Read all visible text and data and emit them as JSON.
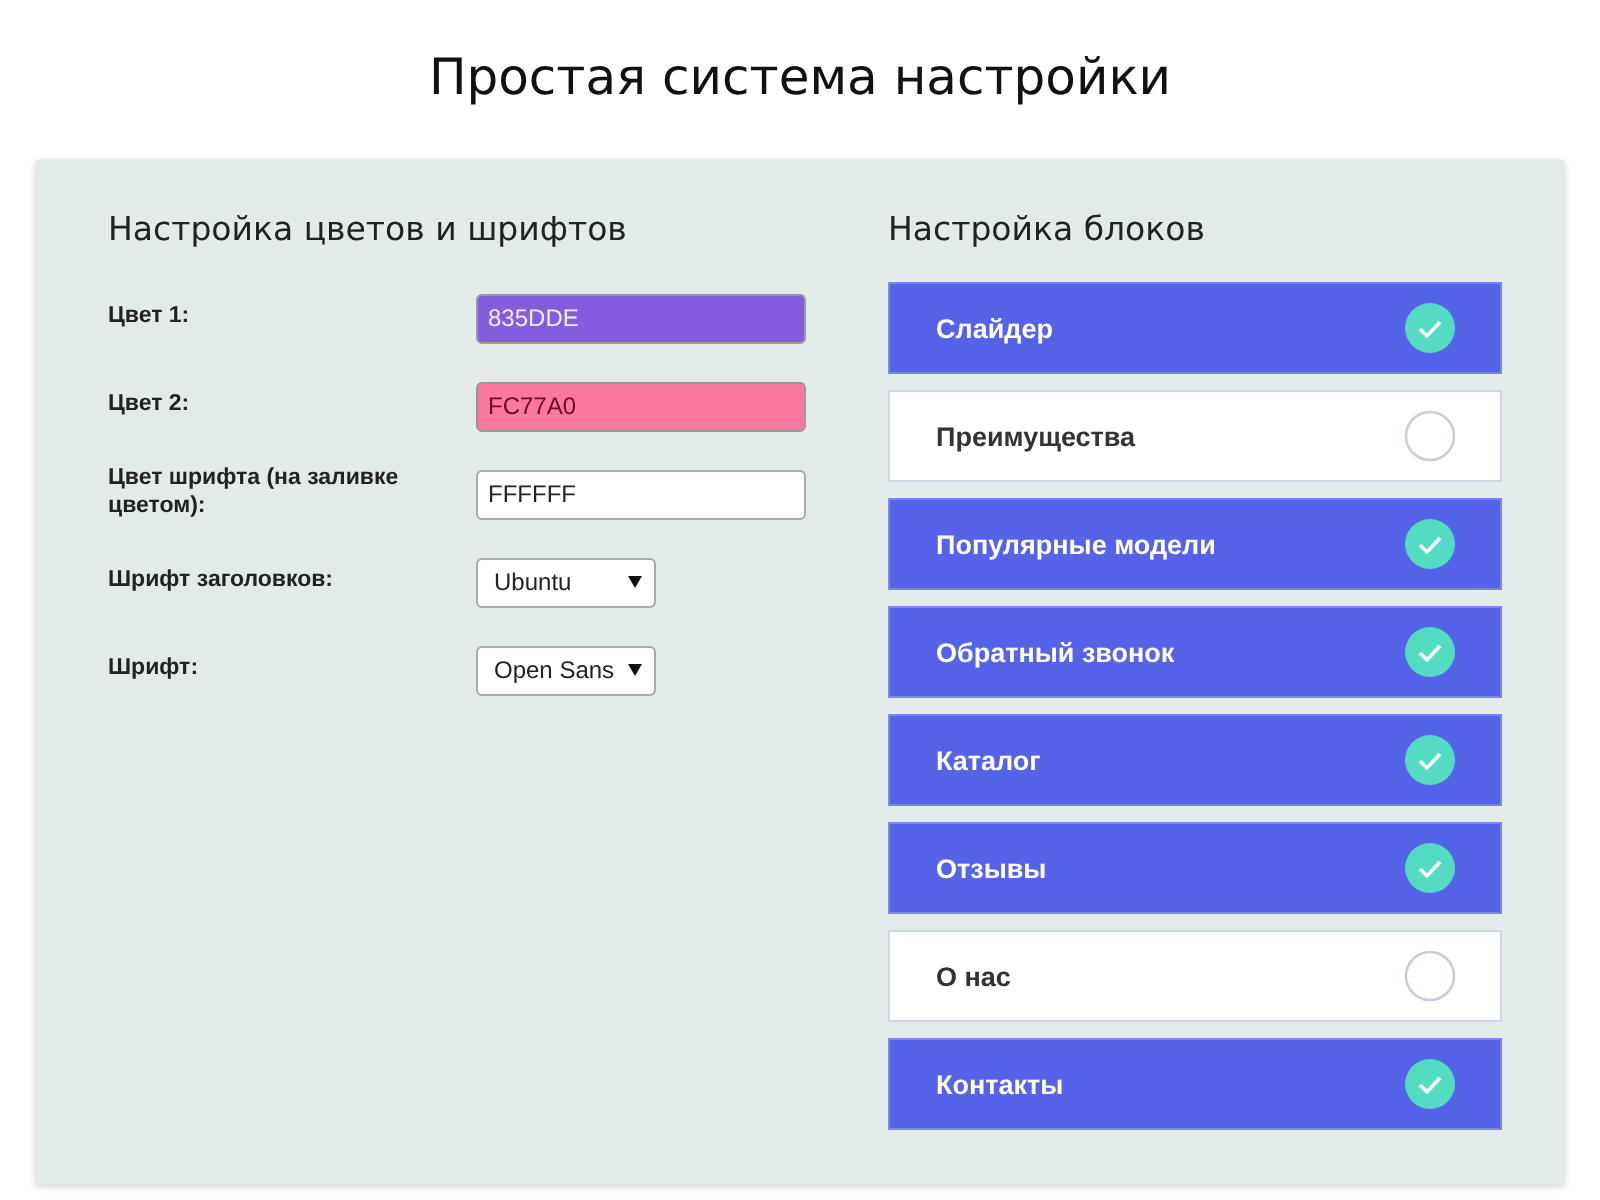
{
  "title": "Простая система настройки",
  "colors_section": {
    "heading": "Настройка цветов и шрифтов",
    "fields": [
      {
        "kind": "color",
        "label": "Цвет 1:",
        "value": "835DDE",
        "color": "#835dde"
      },
      {
        "kind": "color",
        "label": "Цвет 2:",
        "value": "FC77A0",
        "color": "#fc77a0"
      },
      {
        "kind": "text",
        "label": "Цвет шрифта (на заливке цветом):",
        "value": "FFFFFF"
      },
      {
        "kind": "select",
        "label": "Шрифт заголовков:",
        "value": "Ubuntu"
      },
      {
        "kind": "select",
        "label": "Шрифт:",
        "value": "Open Sans"
      }
    ]
  },
  "blocks_section": {
    "heading": "Настройка блоков",
    "items": [
      {
        "label": "Слайдер",
        "checked": true
      },
      {
        "label": "Преимущества",
        "checked": false
      },
      {
        "label": "Популярные модели",
        "checked": true
      },
      {
        "label": "Обратный звонок",
        "checked": true
      },
      {
        "label": "Каталог",
        "checked": true
      },
      {
        "label": "Отзывы",
        "checked": true
      },
      {
        "label": "О нас",
        "checked": false
      },
      {
        "label": "Контакты",
        "checked": true
      }
    ]
  }
}
